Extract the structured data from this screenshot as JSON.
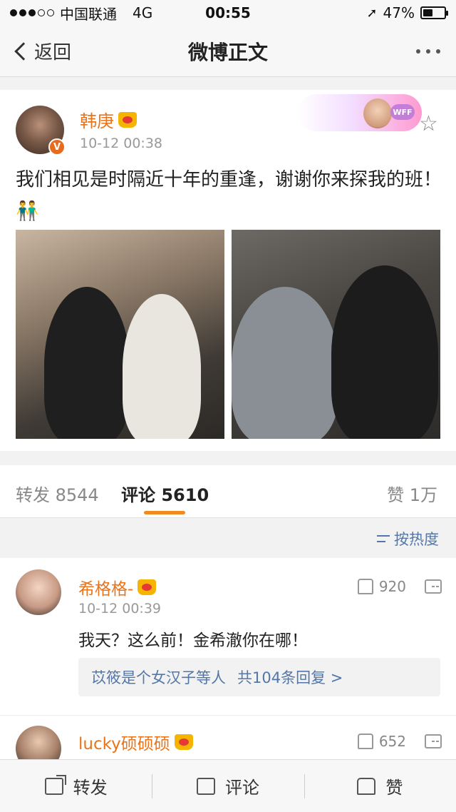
{
  "status_bar": {
    "carrier": "中国联通",
    "network": "4G",
    "time": "00:55",
    "battery": "47%",
    "battery_level": 0.47
  },
  "nav": {
    "back_label": "返回",
    "title": "微博正文"
  },
  "post": {
    "username": "韩庚",
    "timestamp": "10-12 00:38",
    "text": "我们相见是时隔近十年的重逢，谢谢你来探我的班！👬",
    "banner_tag": "WFF"
  },
  "tabs": {
    "repost": "转发 8544",
    "comment": "评论 5610",
    "like": "赞 1万"
  },
  "sort": {
    "label": "按热度"
  },
  "comments": [
    {
      "username": "希格格-",
      "timestamp": "10-12 00:39",
      "likes": "920",
      "text": "我天？这么前！金希澈你在哪！",
      "reply_user": "苡筱是个女汉子等人",
      "reply_count": "共104条回复 >"
    },
    {
      "username": "lucky硕硕硕",
      "likes": "652"
    }
  ],
  "toolbar": {
    "repost": "转发",
    "comment": "评论",
    "like": "赞"
  },
  "colors": {
    "username": "#e8741b",
    "link": "#5377a8",
    "tab_accent": "#f28b1f"
  }
}
